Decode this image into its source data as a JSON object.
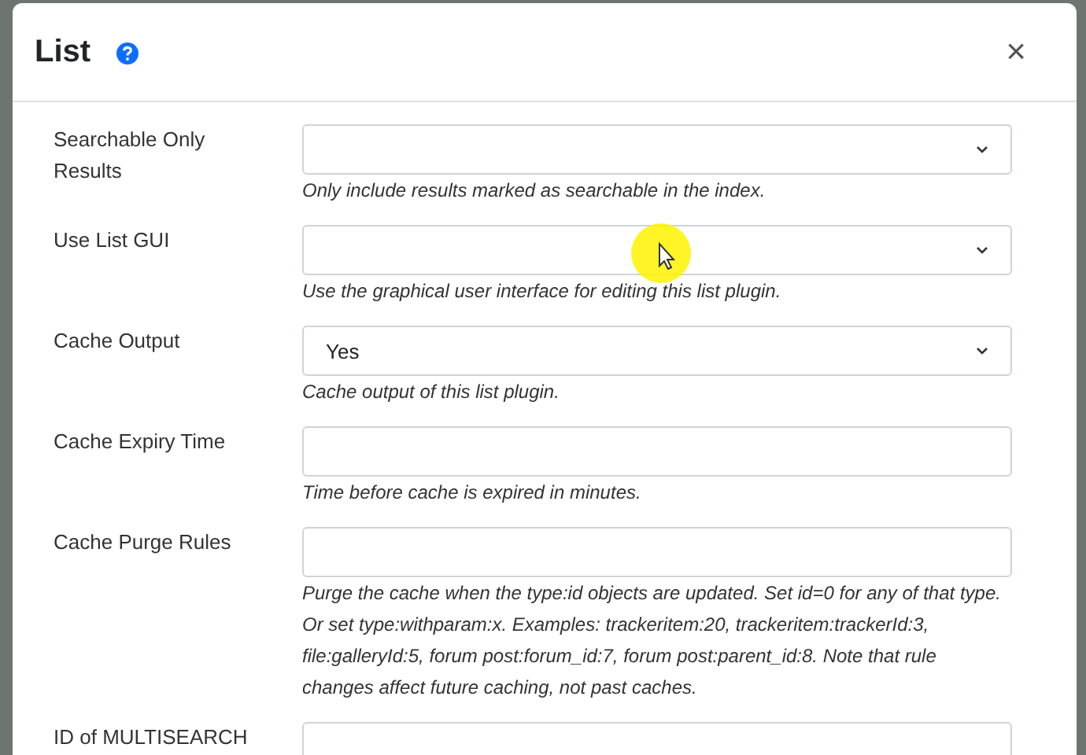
{
  "dialog": {
    "title": "List",
    "close": "×"
  },
  "fields": [
    {
      "label": "Searchable Only Results",
      "kind": "select",
      "help": "Only include results marked as searchable in the index."
    },
    {
      "label": "Use List GUI",
      "kind": "select",
      "help": "Use the graphical user interface for editing this list plugin."
    },
    {
      "label": "Cache Output",
      "kind": "select",
      "value": "Yes",
      "help": "Cache output of this list plugin."
    },
    {
      "label": "Cache Expiry Time",
      "kind": "text",
      "help": "Time before cache is expired in minutes."
    },
    {
      "label": "Cache Purge Rules",
      "kind": "text",
      "help": "Purge the cache when the type:id objects are updated. Set id=0 for any of that type. Or set type:withparam:x. Examples: trackeritem:20, trackeritem:trackerId:3, file:galleryId:5, forum post:forum_id:7, forum post:parent_id:8. Note that rule changes affect future caching, not past caches."
    },
    {
      "label": "ID of MULTISEARCH",
      "kind": "text"
    }
  ]
}
